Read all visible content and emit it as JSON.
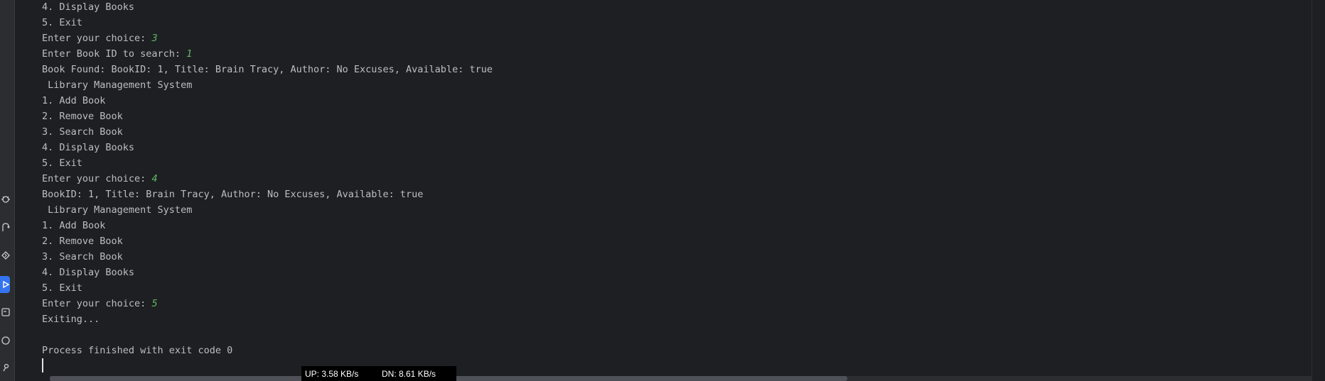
{
  "sidebar": {
    "icons": [
      "debug-icon",
      "commit-icon",
      "services-icon",
      "run-icon",
      "terminal-icon",
      "problems-icon",
      "git-icon"
    ],
    "active_icon": "run-icon",
    "accent_color": "#3574f0"
  },
  "console": {
    "lines": [
      {
        "text": "4. Display Books"
      },
      {
        "text": "5. Exit"
      },
      {
        "text": "Enter your choice: ",
        "input": "3"
      },
      {
        "text": "Enter Book ID to search: ",
        "input": "1"
      },
      {
        "text": "Book Found: BookID: 1, Title: Brain Tracy, Author: No Excuses, Available: true"
      },
      {
        "text": " Library Management System"
      },
      {
        "text": "1. Add Book"
      },
      {
        "text": "2. Remove Book"
      },
      {
        "text": "3. Search Book"
      },
      {
        "text": "4. Display Books"
      },
      {
        "text": "5. Exit"
      },
      {
        "text": "Enter your choice: ",
        "input": "4"
      },
      {
        "text": "BookID: 1, Title: Brain Tracy, Author: No Excuses, Available: true"
      },
      {
        "text": " Library Management System"
      },
      {
        "text": "1. Add Book"
      },
      {
        "text": "2. Remove Book"
      },
      {
        "text": "3. Search Book"
      },
      {
        "text": "4. Display Books"
      },
      {
        "text": "5. Exit"
      },
      {
        "text": "Enter your choice: ",
        "input": "5"
      },
      {
        "text": "Exiting..."
      },
      {
        "text": ""
      },
      {
        "text": "Process finished with exit code 0"
      }
    ],
    "text_color": "#bcbec4",
    "input_color": "#5fb865"
  },
  "netspeed": {
    "up": "UP: 3.58 KB/s",
    "down": "DN: 8.61 KB/s"
  }
}
